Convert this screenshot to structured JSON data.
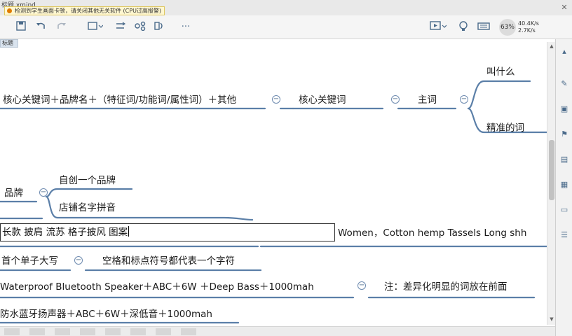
{
  "titlebar": {
    "app_name": "标题.xmind",
    "notice": "检测到学生画面卡顿，请关闭其他无关软件 (CPU过高报警)",
    "close_glyph": "✕"
  },
  "toolbar": {
    "icons": [
      "save-icon",
      "undo-icon",
      "redo-icon",
      "outline-icon",
      "relationship-icon",
      "boundary-icon",
      "summary-icon",
      "more-icon",
      "presentation-icon",
      "idea-icon",
      "keyboard-icon"
    ],
    "more_label": "···",
    "cpu_label": "63%",
    "upload_speed": "40.4K/s",
    "download_speed": "2.7K/s"
  },
  "canvas": {
    "tab_label": "标题",
    "nodes": {
      "formula": "核心关键词＋品牌名＋（特征词/功能词/属性词）＋其他",
      "core_keyword": "核心关键词",
      "main_word": "主词",
      "what_called": "叫什么",
      "precise_word": "精准的词",
      "brand": "品牌",
      "own_brand": "自创一个品牌",
      "store_pinyin": "店铺名字拼音",
      "edit_value": "长款  披肩  流苏    格子披风  图案",
      "english_right": "Women，Cotton hemp Tassels  Long shh",
      "capitalize": "首个单子大写",
      "space_note": "空格和标点符号都代表一个字符",
      "waterproof": "Waterproof  Bluetooth    Speaker＋ABC＋6W ＋Deep  Bass＋1000mah",
      "note_front": "注：差异化明显的词放在前面",
      "chinese_title": "防水蓝牙扬声器＋ABC＋6W＋深低音＋1000mah"
    },
    "collapse_symbol": "−"
  },
  "colors": {
    "branch": "#5b7fa8",
    "toolbar_icon": "#4a6a8a",
    "notice_bg": "#fff7d0"
  }
}
